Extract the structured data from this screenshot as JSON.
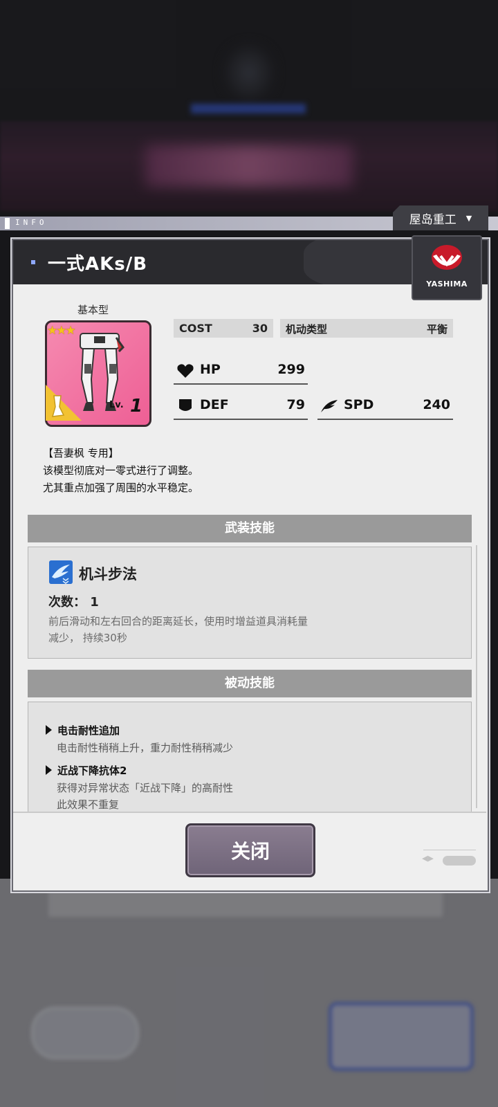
{
  "info_label": "INFO",
  "maker": {
    "name": "屋岛重工",
    "dropdown_icon": "triangle-down-icon",
    "logo_text": "YASHIMA"
  },
  "part": {
    "title": "一式AKs/B",
    "type": "基本型",
    "stars": "★★★",
    "level_prefix": "Lv.",
    "level": "1"
  },
  "stats": {
    "cost_label": "COST",
    "cost_value": "30",
    "mobility_label": "机动类型",
    "mobility_value": "平衡",
    "hp_label": "HP",
    "hp_value": "299",
    "def_label": "DEF",
    "def_value": "79",
    "spd_label": "SPD",
    "spd_value": "240"
  },
  "description": {
    "line1": "【吾妻枫 专用】",
    "line2": "该模型彻底对一零式进行了调整。",
    "line3": "尤其重点加强了周围的水平稳定。"
  },
  "armed_skill": {
    "header": "武装技能",
    "name": "机斗步法",
    "count_label": "次数：",
    "count_value": "1",
    "desc_line1": "前后滑动和左右回合的距离延长，使用时增益道具消耗量",
    "desc_line2": "减少，  持续30秒"
  },
  "passive_skill": {
    "header": "被动技能",
    "items": [
      {
        "name": "电击耐性追加",
        "desc": [
          "电击耐性稍稍上升，重力耐性稍稍减少"
        ]
      },
      {
        "name": "近战下降抗体2",
        "desc": [
          "获得对异常状态「近战下降」的高耐性",
          "此效果不重复"
        ]
      }
    ]
  },
  "close_button": "关闭",
  "colors": {
    "card_pink": "#ee5f95",
    "header_dark": "#2a2a2e",
    "section_gray": "#9a9a9a",
    "accent_blue": "#2a6fd0"
  }
}
